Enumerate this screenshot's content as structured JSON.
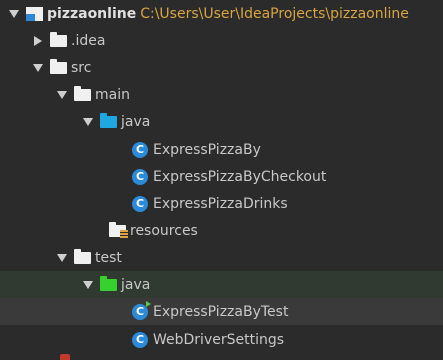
{
  "project": {
    "name": "pizzaonline",
    "path": "C:\\Users\\User\\IdeaProjects\\pizzaonline"
  },
  "folders": {
    "idea": ".idea",
    "src": "src",
    "main": "main",
    "main_java": "java",
    "resources": "resources",
    "test": "test",
    "test_java": "java"
  },
  "classes": {
    "main": [
      "ExpressPizzaBy",
      "ExpressPizzaByCheckout",
      "ExpressPizzaDrinks"
    ],
    "test": [
      "ExpressPizzaByTest",
      "WebDriverSettings"
    ]
  },
  "icons": {
    "class_letter": "C"
  },
  "colors": {
    "background": "#2b2b2b",
    "test_row_highlight": "#313a31",
    "selected_row": "#3a3a3a",
    "path_text": "#d9a441",
    "java_folder_main": "#1ea7e1",
    "java_folder_test": "#36d12e",
    "class_icon": "#2b8bd8"
  }
}
